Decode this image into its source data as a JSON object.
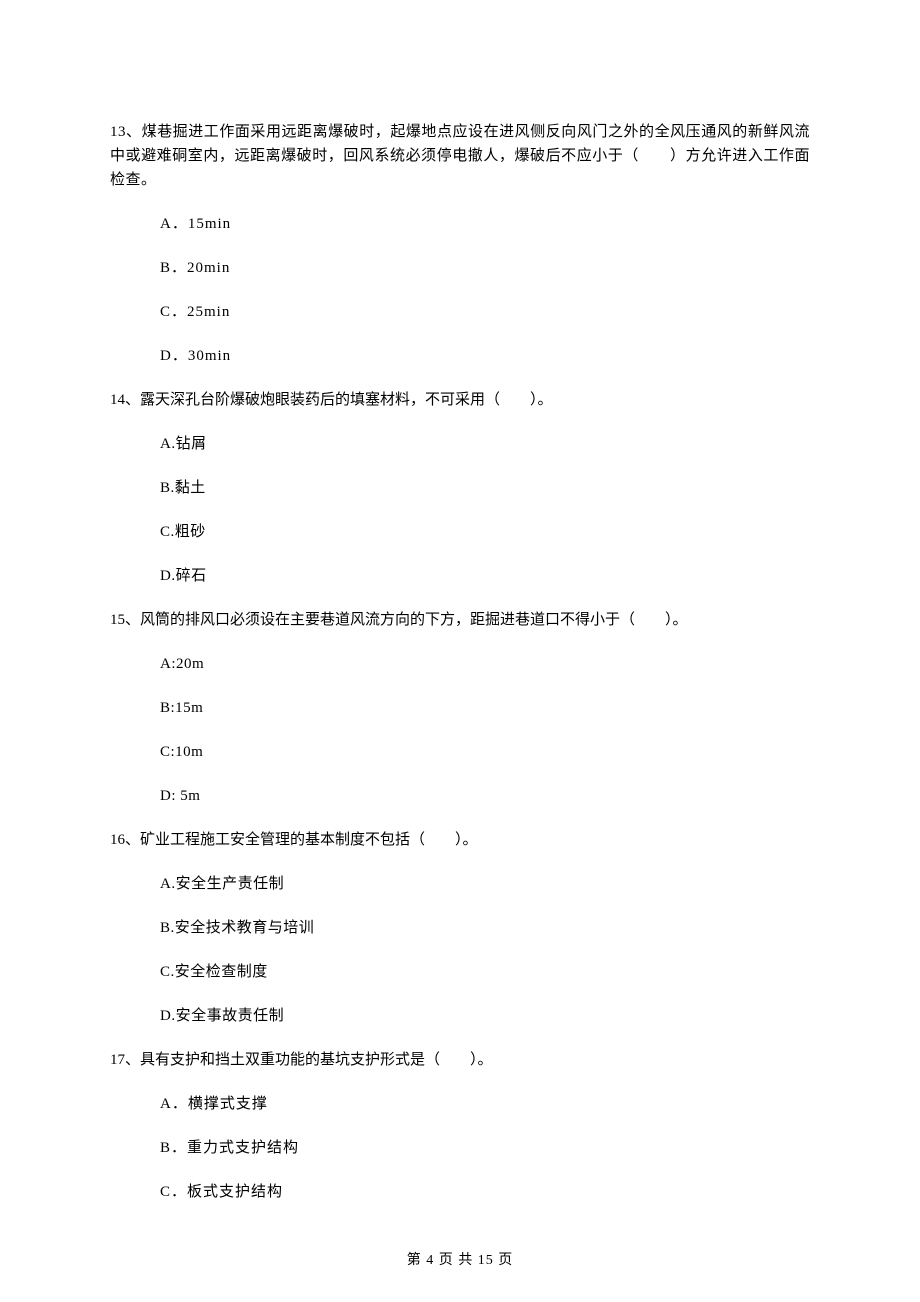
{
  "questions": {
    "q13": {
      "stem": "13、煤巷掘进工作面采用远距离爆破时，起爆地点应设在进风侧反向风门之外的全风压通风的新鲜风流中或避难硐室内，远距离爆破时，回风系统必须停电撤人，爆破后不应小于（　　）方允许进入工作面检查。",
      "opts": {
        "A": "A．15min",
        "B": "B．20min",
        "C": "C．25min",
        "D": "D．30min"
      }
    },
    "q14": {
      "stem": "14、露天深孔台阶爆破炮眼装药后的填塞材料，不可采用（　　）。",
      "opts": {
        "A": "A.钻屑",
        "B": "B.黏土",
        "C": "C.粗砂",
        "D": "D.碎石"
      }
    },
    "q15": {
      "stem": "15、风筒的排风口必须设在主要巷道风流方向的下方，距掘进巷道口不得小于（　　）。",
      "opts": {
        "A": "A:20m",
        "B": "B:15m",
        "C": "C:10m",
        "D": "D: 5m"
      }
    },
    "q16": {
      "stem": "16、矿业工程施工安全管理的基本制度不包括（　　）。",
      "opts": {
        "A": "A.安全生产责任制",
        "B": "B.安全技术教育与培训",
        "C": "C.安全检查制度",
        "D": "D.安全事故责任制"
      }
    },
    "q17": {
      "stem": "17、具有支护和挡土双重功能的基坑支护形式是（　　）。",
      "opts": {
        "A": "A．横撑式支撑",
        "B": "B．重力式支护结构",
        "C": "C．板式支护结构"
      }
    }
  },
  "footer": "第 4 页 共 15 页"
}
